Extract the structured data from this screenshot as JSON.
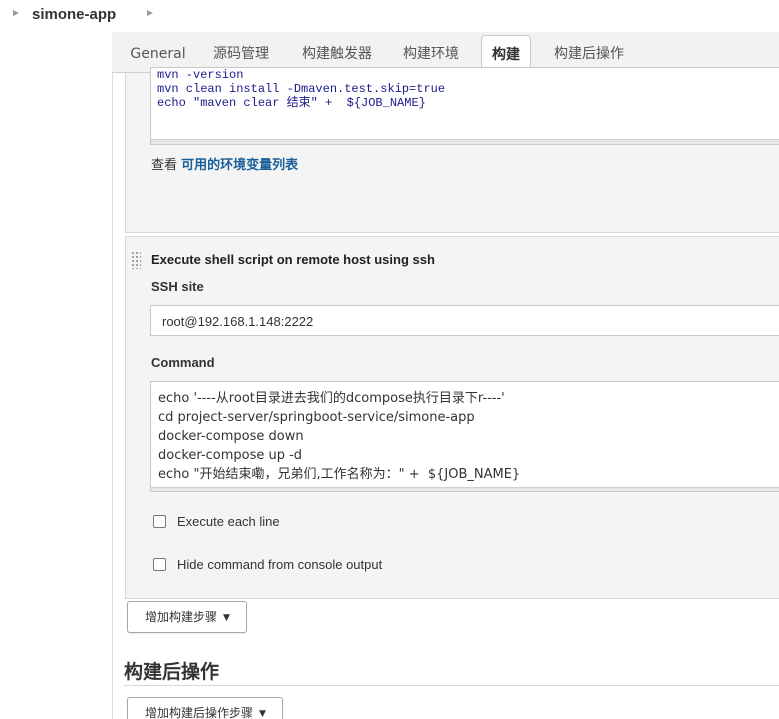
{
  "breadcrumb": {
    "title": "simone-app",
    "sep_icon": "chevron-right-icon"
  },
  "tabs": [
    {
      "label": "General",
      "active": false
    },
    {
      "label": "源码管理",
      "active": false
    },
    {
      "label": "构建触发器",
      "active": false
    },
    {
      "label": "构建环境",
      "active": false
    },
    {
      "label": "构建",
      "active": true
    },
    {
      "label": "构建后操作",
      "active": false
    }
  ],
  "maven_step": {
    "code_lines": [
      "mvn -version",
      "mvn clean install -Dmaven.test.skip=true",
      "echo \"maven clear 结束\" +  ${JOB_NAME}"
    ],
    "env_prefix": "查看 ",
    "env_link": "可用的环境变量列表"
  },
  "ssh_step": {
    "title": "Execute shell script on remote host using ssh",
    "ssh_site_label": "SSH site",
    "ssh_site_value": "root@192.168.1.148:2222",
    "command_label": "Command",
    "command_lines": [
      "echo '----从root目录进去我们的dcompose执行目录下r----'",
      "cd project-server/springboot-service/simone-app",
      "docker-compose down",
      "docker-compose up -d",
      "echo \"开始结束嘞，兄弟们,工作名称为：\" +  ${JOB_NAME}"
    ],
    "execute_each_line_label": "Execute each line",
    "hide_command_label": "Hide command from console output"
  },
  "buttons": {
    "add_build_step": "增加构建步骤",
    "add_post_build_step": "增加构建后操作步骤",
    "caret_icon": "caret-down-icon"
  },
  "post_build": {
    "heading": "构建后操作"
  },
  "colors": {
    "link": "#1a5f99",
    "code_text": "#1a1a8c",
    "panel_bg": "#f4f4f4",
    "tabbar_bg": "#f2f2f2"
  }
}
